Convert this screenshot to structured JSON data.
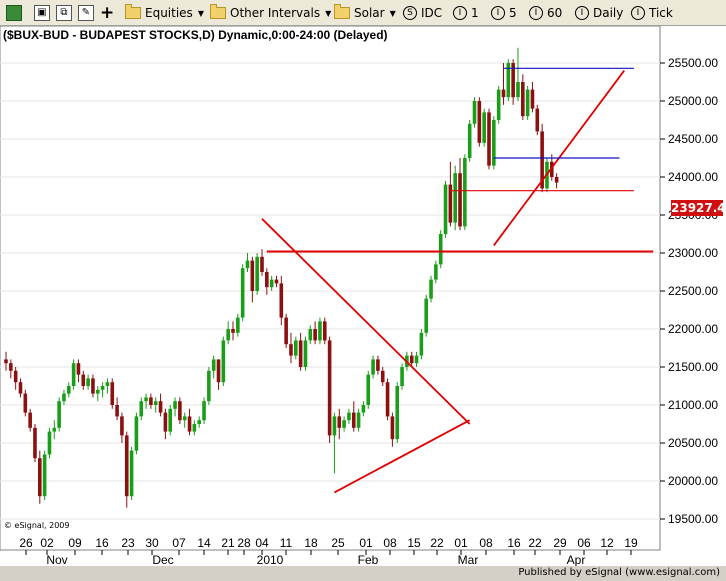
{
  "toolbar": {
    "equities_label": "Equities",
    "other_intervals_label": "Other Intervals",
    "solar_label": "Solar",
    "idc_label": "IDC",
    "interval_1": "1",
    "interval_5": "5",
    "interval_60": "60",
    "daily_label": "Daily",
    "tick_label": "Tick"
  },
  "colors": {
    "up": "#1a9e1a",
    "down": "#8b1010",
    "trend": "#e00000",
    "level_blue": "#1010c0",
    "axis_bg": "#ffffff"
  },
  "chart_data": {
    "type": "candlestick",
    "title": "($BUX-BUD - BUDAPEST STOCKS,D) Dynamic,0:00-24:00 (Delayed)",
    "ylim": [
      19300,
      26000
    ],
    "y_ticks": [
      "19500.00",
      "20000.00",
      "20500.00",
      "21000.00",
      "21500.00",
      "22000.00",
      "22500.00",
      "23000.00",
      "23500.00",
      "24000.00",
      "24500.00",
      "25000.00",
      "25500.00"
    ],
    "x_day_ticks": [
      "26",
      "02",
      "09",
      "16",
      "23",
      "30",
      "07",
      "14",
      "21",
      "28",
      "04",
      "11",
      "18",
      "25",
      "01",
      "08",
      "15",
      "22",
      "01",
      "08",
      "16",
      "22",
      "29",
      "06",
      "12",
      "19"
    ],
    "x_month_labels": [
      "Nov",
      "Dec",
      "2010",
      "Feb",
      "Mar",
      "Apr"
    ],
    "last_price": "23927.45",
    "copyright": "© eSignal, 2009",
    "candles": [
      [
        21600,
        21700,
        21450,
        21550
      ],
      [
        21550,
        21600,
        21350,
        21450
      ],
      [
        21450,
        21500,
        21200,
        21300
      ],
      [
        21300,
        21350,
        21100,
        21150
      ],
      [
        21150,
        21200,
        20850,
        20900
      ],
      [
        20900,
        20950,
        20650,
        20700
      ],
      [
        20700,
        20750,
        20250,
        20300
      ],
      [
        20300,
        20400,
        19700,
        19800
      ],
      [
        19800,
        20400,
        19750,
        20350
      ],
      [
        20350,
        20700,
        20300,
        20650
      ],
      [
        20650,
        20800,
        20550,
        20700
      ],
      [
        20700,
        21100,
        20650,
        21050
      ],
      [
        21050,
        21200,
        21000,
        21150
      ],
      [
        21150,
        21300,
        21100,
        21250
      ],
      [
        21250,
        21600,
        21200,
        21550
      ],
      [
        21550,
        21600,
        21300,
        21400
      ],
      [
        21400,
        21450,
        21200,
        21250
      ],
      [
        21250,
        21400,
        21200,
        21350
      ],
      [
        21350,
        21400,
        21100,
        21150
      ],
      [
        21150,
        21250,
        21050,
        21200
      ],
      [
        21200,
        21300,
        21100,
        21250
      ],
      [
        21250,
        21350,
        21150,
        21300
      ],
      [
        21300,
        21350,
        20950,
        21000
      ],
      [
        21000,
        21100,
        20800,
        20850
      ],
      [
        20850,
        20900,
        20500,
        20600
      ],
      [
        20600,
        20650,
        19650,
        19800
      ],
      [
        19800,
        20450,
        19750,
        20400
      ],
      [
        20400,
        20900,
        20350,
        20850
      ],
      [
        20850,
        21100,
        20800,
        21050
      ],
      [
        21050,
        21150,
        20950,
        21100
      ],
      [
        21100,
        21150,
        20950,
        21000
      ],
      [
        21000,
        21100,
        20900,
        21050
      ],
      [
        21050,
        21150,
        20850,
        20900
      ],
      [
        20900,
        20950,
        20550,
        20650
      ],
      [
        20650,
        21000,
        20600,
        20950
      ],
      [
        20950,
        21100,
        20850,
        21050
      ],
      [
        21050,
        21100,
        20750,
        20800
      ],
      [
        20800,
        20900,
        20700,
        20850
      ],
      [
        20850,
        20950,
        20600,
        20650
      ],
      [
        20650,
        20800,
        20600,
        20750
      ],
      [
        20750,
        20850,
        20700,
        20800
      ],
      [
        20800,
        21100,
        20750,
        21050
      ],
      [
        21050,
        21500,
        21000,
        21450
      ],
      [
        21450,
        21650,
        21350,
        21600
      ],
      [
        21600,
        21600,
        21200,
        21300
      ],
      [
        21300,
        21900,
        21250,
        21850
      ],
      [
        21850,
        22100,
        21800,
        22000
      ],
      [
        22000,
        22100,
        21850,
        21950
      ],
      [
        21950,
        22200,
        21900,
        22150
      ],
      [
        22150,
        22850,
        22100,
        22800
      ],
      [
        22800,
        23000,
        22750,
        22900
      ],
      [
        22900,
        22950,
        22350,
        22500
      ],
      [
        22500,
        23000,
        22450,
        22950
      ],
      [
        22950,
        23050,
        22700,
        22750
      ],
      [
        22750,
        22800,
        22450,
        22550
      ],
      [
        22550,
        22700,
        22500,
        22650
      ],
      [
        22650,
        22700,
        22550,
        22600
      ],
      [
        22600,
        22700,
        22050,
        22150
      ],
      [
        22150,
        22200,
        21750,
        21800
      ],
      [
        21800,
        21950,
        21550,
        21650
      ],
      [
        21650,
        21900,
        21600,
        21850
      ],
      [
        21850,
        21950,
        21450,
        21500
      ],
      [
        21500,
        21900,
        21450,
        21850
      ],
      [
        21850,
        22050,
        21800,
        22000
      ],
      [
        22000,
        22100,
        21800,
        21850
      ],
      [
        21850,
        22150,
        21800,
        22100
      ],
      [
        22100,
        22150,
        21800,
        21850
      ],
      [
        21850,
        21900,
        20500,
        20600
      ],
      [
        20600,
        20900,
        20100,
        20850
      ],
      [
        20850,
        20950,
        20550,
        20700
      ],
      [
        20700,
        20850,
        20650,
        20800
      ],
      [
        20800,
        20950,
        20750,
        20900
      ],
      [
        20900,
        21050,
        20650,
        20700
      ],
      [
        20700,
        20950,
        20650,
        20900
      ],
      [
        20900,
        21050,
        20850,
        21000
      ],
      [
        21000,
        21450,
        20950,
        21400
      ],
      [
        21400,
        21650,
        21350,
        21600
      ],
      [
        21600,
        21650,
        21400,
        21450
      ],
      [
        21450,
        21500,
        21250,
        21300
      ],
      [
        21300,
        21350,
        20800,
        20850
      ],
      [
        20850,
        20900,
        20450,
        20550
      ],
      [
        20550,
        21300,
        20500,
        21250
      ],
      [
        21250,
        21550,
        21200,
        21500
      ],
      [
        21500,
        21700,
        21450,
        21650
      ],
      [
        21650,
        21700,
        21500,
        21550
      ],
      [
        21550,
        21700,
        21500,
        21650
      ],
      [
        21650,
        22000,
        21600,
        21950
      ],
      [
        21950,
        22450,
        21900,
        22400
      ],
      [
        22400,
        22700,
        22350,
        22650
      ],
      [
        22650,
        22900,
        22600,
        22850
      ],
      [
        22850,
        23300,
        22800,
        23250
      ],
      [
        23250,
        23950,
        23200,
        23900
      ],
      [
        23900,
        24200,
        23350,
        23400
      ],
      [
        23400,
        24150,
        23300,
        24050
      ],
      [
        24050,
        24250,
        23300,
        23350
      ],
      [
        23350,
        24300,
        23300,
        24250
      ],
      [
        24250,
        24750,
        24200,
        24700
      ],
      [
        24700,
        25050,
        24650,
        25000
      ],
      [
        25000,
        25050,
        24400,
        24450
      ],
      [
        24450,
        24900,
        24400,
        24850
      ],
      [
        24850,
        24900,
        24100,
        24150
      ],
      [
        24150,
        24800,
        24100,
        24750
      ],
      [
        24750,
        25200,
        24700,
        25150
      ],
      [
        25150,
        25500,
        24950,
        25050
      ],
      [
        25050,
        25550,
        25000,
        25500
      ],
      [
        25500,
        25550,
        24950,
        25050
      ],
      [
        25050,
        25700,
        25000,
        25250
      ],
      [
        25250,
        25350,
        24750,
        24800
      ],
      [
        24800,
        25200,
        24750,
        25150
      ],
      [
        25150,
        25250,
        24850,
        24900
      ],
      [
        24900,
        24950,
        24550,
        24600
      ],
      [
        24600,
        24700,
        23800,
        23850
      ],
      [
        23850,
        24250,
        23800,
        24200
      ],
      [
        24200,
        24300,
        23950,
        24000
      ],
      [
        24000,
        24050,
        23850,
        23927
      ]
    ],
    "trendlines": [
      {
        "color": "red",
        "from": [
          53,
          23450
        ],
        "to": [
          96,
          20750
        ]
      },
      {
        "color": "red",
        "from": [
          68,
          19850
        ],
        "to": [
          96,
          20800
        ]
      },
      {
        "color": "red",
        "from": [
          101,
          23100
        ],
        "to": [
          128,
          25400
        ]
      }
    ],
    "levels": [
      {
        "color": "red",
        "value": 23020,
        "from": 54,
        "to": 134
      },
      {
        "color": "blue",
        "value": 25430,
        "from": 103,
        "to": 130
      },
      {
        "color": "blue",
        "value": 24250,
        "from": 101,
        "to": 127
      },
      {
        "color": "red",
        "value": 23820,
        "from": 92,
        "to": 130
      }
    ]
  },
  "footer": {
    "publisher": "Published by eSignal (www.esignal.com)"
  }
}
